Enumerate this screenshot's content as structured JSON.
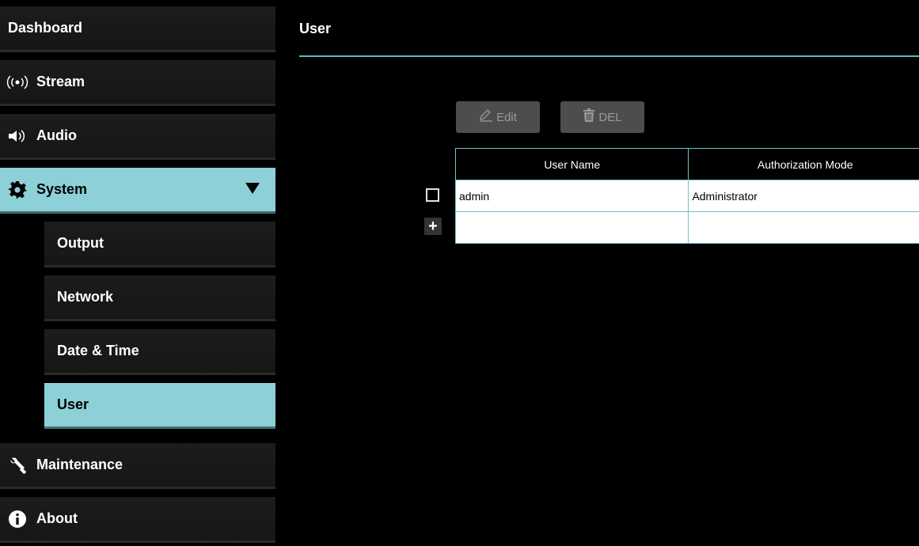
{
  "sidebar": {
    "dashboard": "Dashboard",
    "stream": "Stream",
    "audio": "Audio",
    "system": "System",
    "system_sub": [
      "Output",
      "Network",
      "Date & Time",
      "User"
    ],
    "maintenance": "Maintenance",
    "about": "About",
    "active_color": "#8dd0d8"
  },
  "main": {
    "title": "User",
    "edit_label": "Edit",
    "del_label": "DEL",
    "table": {
      "headers": [
        "User Name",
        "Authorization Mode"
      ],
      "rows": [
        [
          "admin",
          "Administrator"
        ],
        [
          "",
          ""
        ]
      ]
    },
    "accent": "#5fb6bf"
  },
  "icons": {
    "stream": "broadcast-icon",
    "audio": "speaker-icon",
    "system": "gear-icon",
    "maintenance": "wrench-icon",
    "about": "info-icon",
    "edit": "pencil-icon",
    "del": "trash-icon",
    "add": "plus-icon"
  }
}
